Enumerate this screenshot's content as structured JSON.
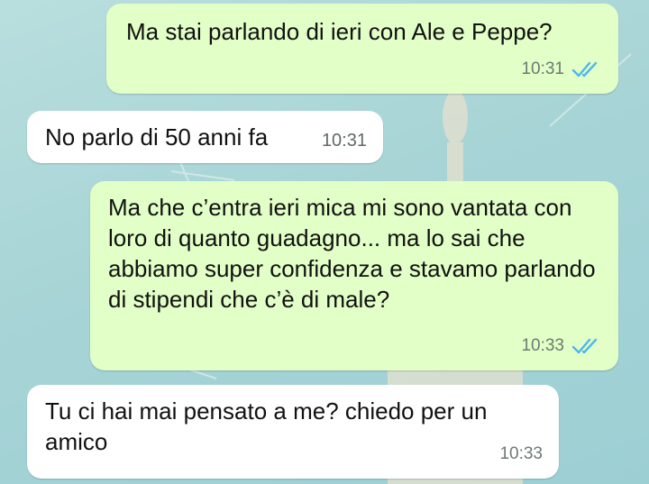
{
  "messages": [
    {
      "direction": "outgoing",
      "text": "Ma stai parlando di ieri con Ale e Peppe?",
      "time": "10:31",
      "status_icon": "double-check-read-icon"
    },
    {
      "direction": "incoming",
      "text": "No parlo di 50 anni fa",
      "time": "10:31"
    },
    {
      "direction": "outgoing",
      "text": "Ma che c’entra ieri mica mi sono vantata con loro di quanto guadagno... ma lo sai che abbiamo super confidenza e stavamo parlando di stipendi che c’è di male?",
      "time": "10:33",
      "status_icon": "double-check-read-icon"
    },
    {
      "direction": "incoming",
      "text": "Tu ci hai mai pensato a me? chiedo per un amico",
      "time": "10:33"
    }
  ],
  "colors": {
    "outgoing_bubble": "#e2ffc7",
    "incoming_bubble": "#ffffff",
    "read_ticks": "#4fb6ec",
    "wallpaper": "#a7d4d6"
  }
}
